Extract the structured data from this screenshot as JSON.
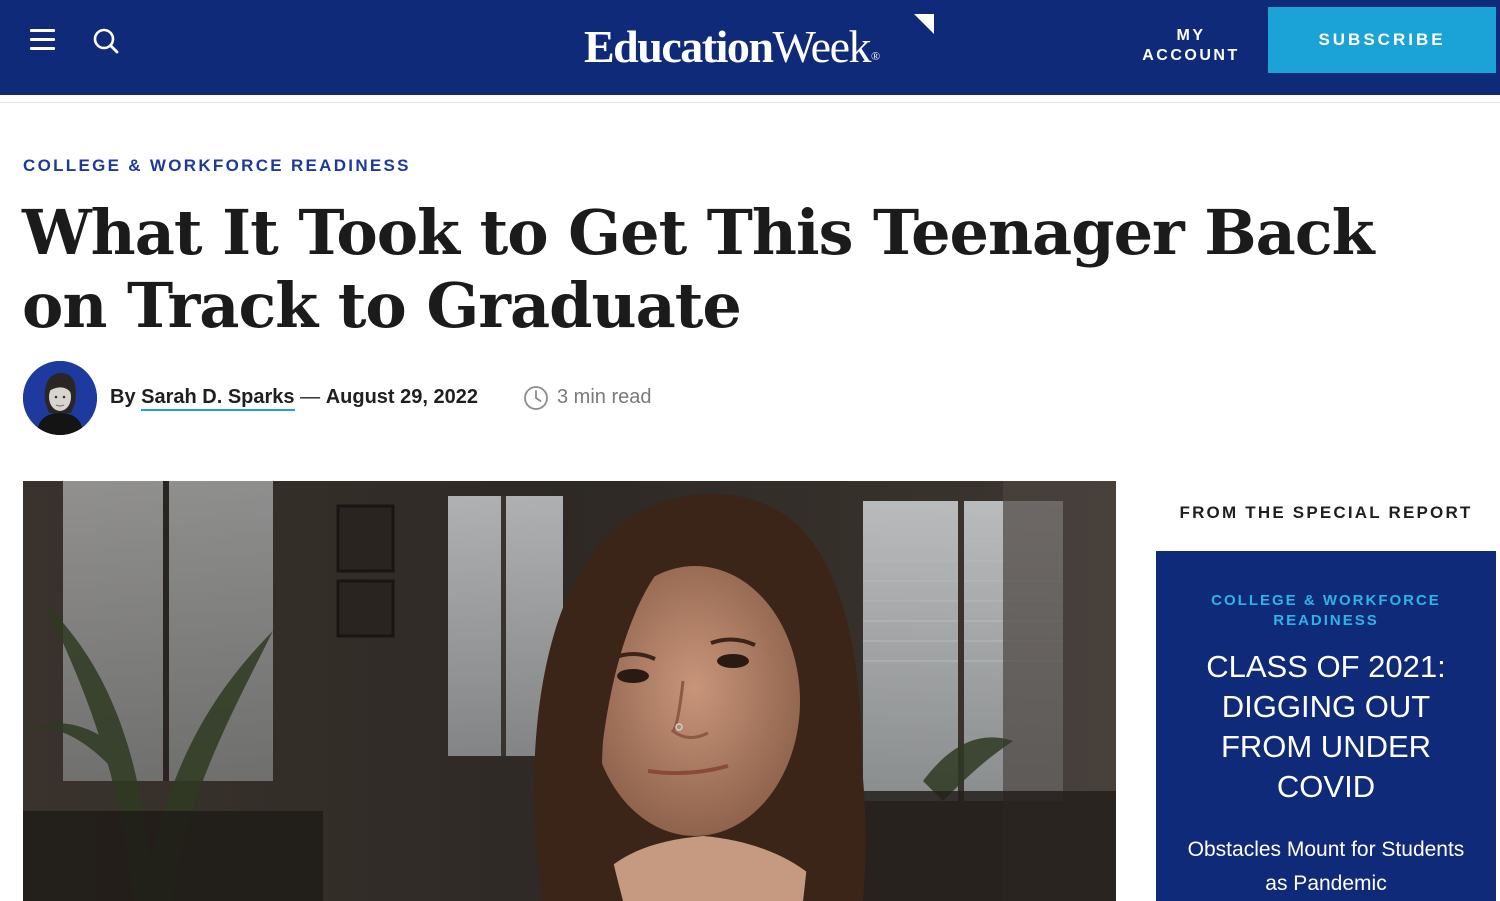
{
  "header": {
    "logo_bold": "Education",
    "logo_regular": "Week",
    "logo_reg_mark": "®",
    "account_line1": "MY",
    "account_line2": "ACCOUNT",
    "subscribe_label": "SUBSCRIBE",
    "colors": {
      "background": "#0f2a78",
      "subscribe": "#1ba3d8"
    }
  },
  "article": {
    "category": "COLLEGE & WORKFORCE READINESS",
    "headline": "What It Took to Get This Teenager Back on Track to Graduate",
    "byline_prefix": "By",
    "author": "Sarah D. Sparks",
    "date_separator": "—",
    "date": "August 29, 2022",
    "read_time": "3 min read"
  },
  "sidebar": {
    "label": "FROM THE SPECIAL REPORT",
    "report_category": "COLLEGE & WORKFORCE READINESS",
    "report_title": "CLASS OF 2021: DIGGING OUT FROM UNDER COVID",
    "report_subtitle": "Obstacles Mount for Students as Pandemic"
  },
  "icons": [
    "menu-icon",
    "search-icon",
    "clock-icon"
  ]
}
